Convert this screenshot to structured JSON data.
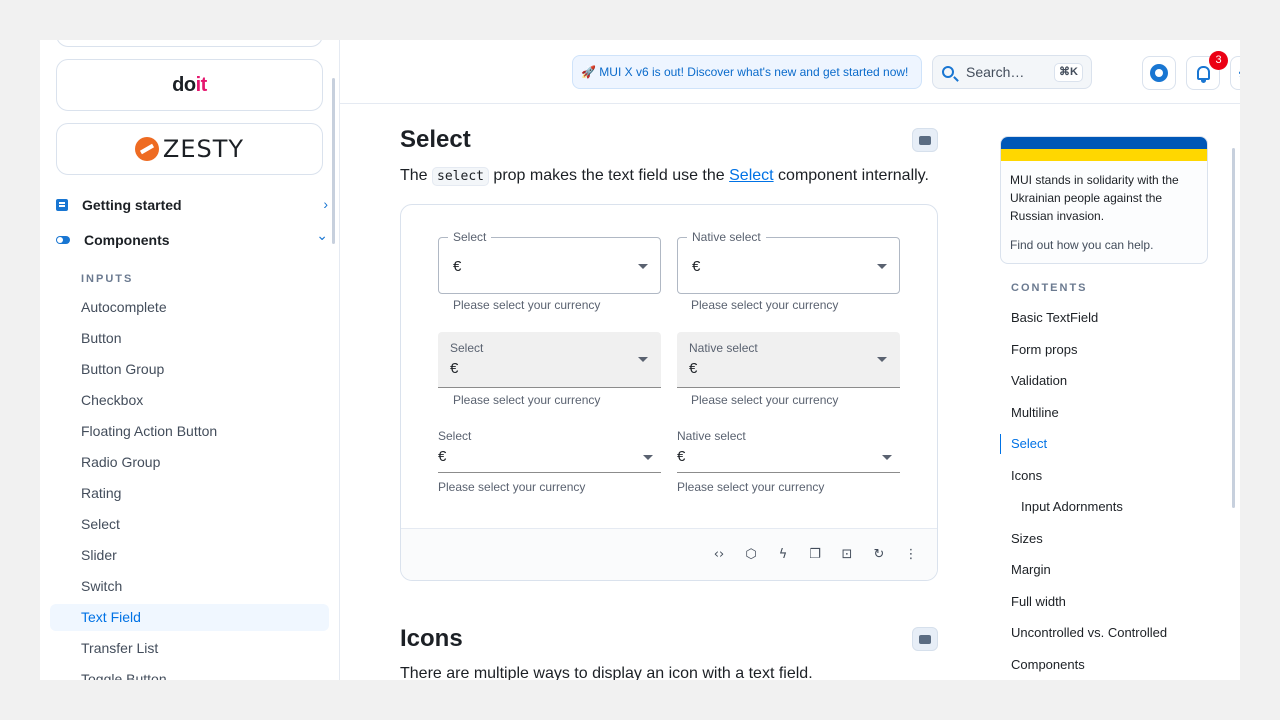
{
  "sidebar": {
    "sponsors": [
      {
        "name": "doit",
        "prefix": "do",
        "suffix": "it"
      },
      {
        "name": "zesty",
        "text": "ZESTY"
      }
    ],
    "sections": [
      {
        "label": "Getting started",
        "icon": "document-icon",
        "chevron": "›"
      },
      {
        "label": "Components",
        "icon": "toggle-icon",
        "chevron": "⌄"
      }
    ],
    "heading": "INPUTS",
    "items": [
      {
        "label": "Autocomplete"
      },
      {
        "label": "Button"
      },
      {
        "label": "Button Group"
      },
      {
        "label": "Checkbox"
      },
      {
        "label": "Floating Action Button"
      },
      {
        "label": "Radio Group"
      },
      {
        "label": "Rating"
      },
      {
        "label": "Select"
      },
      {
        "label": "Slider"
      },
      {
        "label": "Switch"
      },
      {
        "label": "Text Field",
        "active": true
      },
      {
        "label": "Transfer List"
      },
      {
        "label": "Toggle Button"
      }
    ]
  },
  "header": {
    "banner": "🚀 MUI X v6 is out! Discover what's new and get started now!",
    "search_placeholder": "Search…",
    "search_shortcut": "⌘K",
    "notification_count": "3",
    "accent": "#1976d2"
  },
  "main": {
    "select_section": {
      "title": "Select",
      "para_before": "The ",
      "code": "select",
      "para_middle": " prop makes the text field use the ",
      "link": "Select",
      "para_after": " component internally."
    },
    "fields": {
      "select_label": "Select",
      "native_label": "Native select",
      "value": "€",
      "helper": "Please select your currency"
    },
    "toolbar": [
      "code-icon",
      "sandbox-icon",
      "bolt-icon",
      "copy-icon",
      "screenshot-icon",
      "reset-icon",
      "more-icon"
    ],
    "icons_section": {
      "title": "Icons",
      "para": "There are multiple ways to display an icon with a text field."
    }
  },
  "aside": {
    "ukraine_text": "MUI stands in solidarity with the Ukrainian people against the Russian invasion.",
    "ukraine_link": "Find out how you can help.",
    "contents_heading": "CONTENTS",
    "toc": [
      {
        "label": "Basic TextField"
      },
      {
        "label": "Form props"
      },
      {
        "label": "Validation"
      },
      {
        "label": "Multiline"
      },
      {
        "label": "Select",
        "active": true
      },
      {
        "label": "Icons"
      },
      {
        "label": "Input Adornments",
        "sub": true
      },
      {
        "label": "Sizes"
      },
      {
        "label": "Margin"
      },
      {
        "label": "Full width"
      },
      {
        "label": "Uncontrolled vs. Controlled"
      },
      {
        "label": "Components"
      }
    ]
  }
}
